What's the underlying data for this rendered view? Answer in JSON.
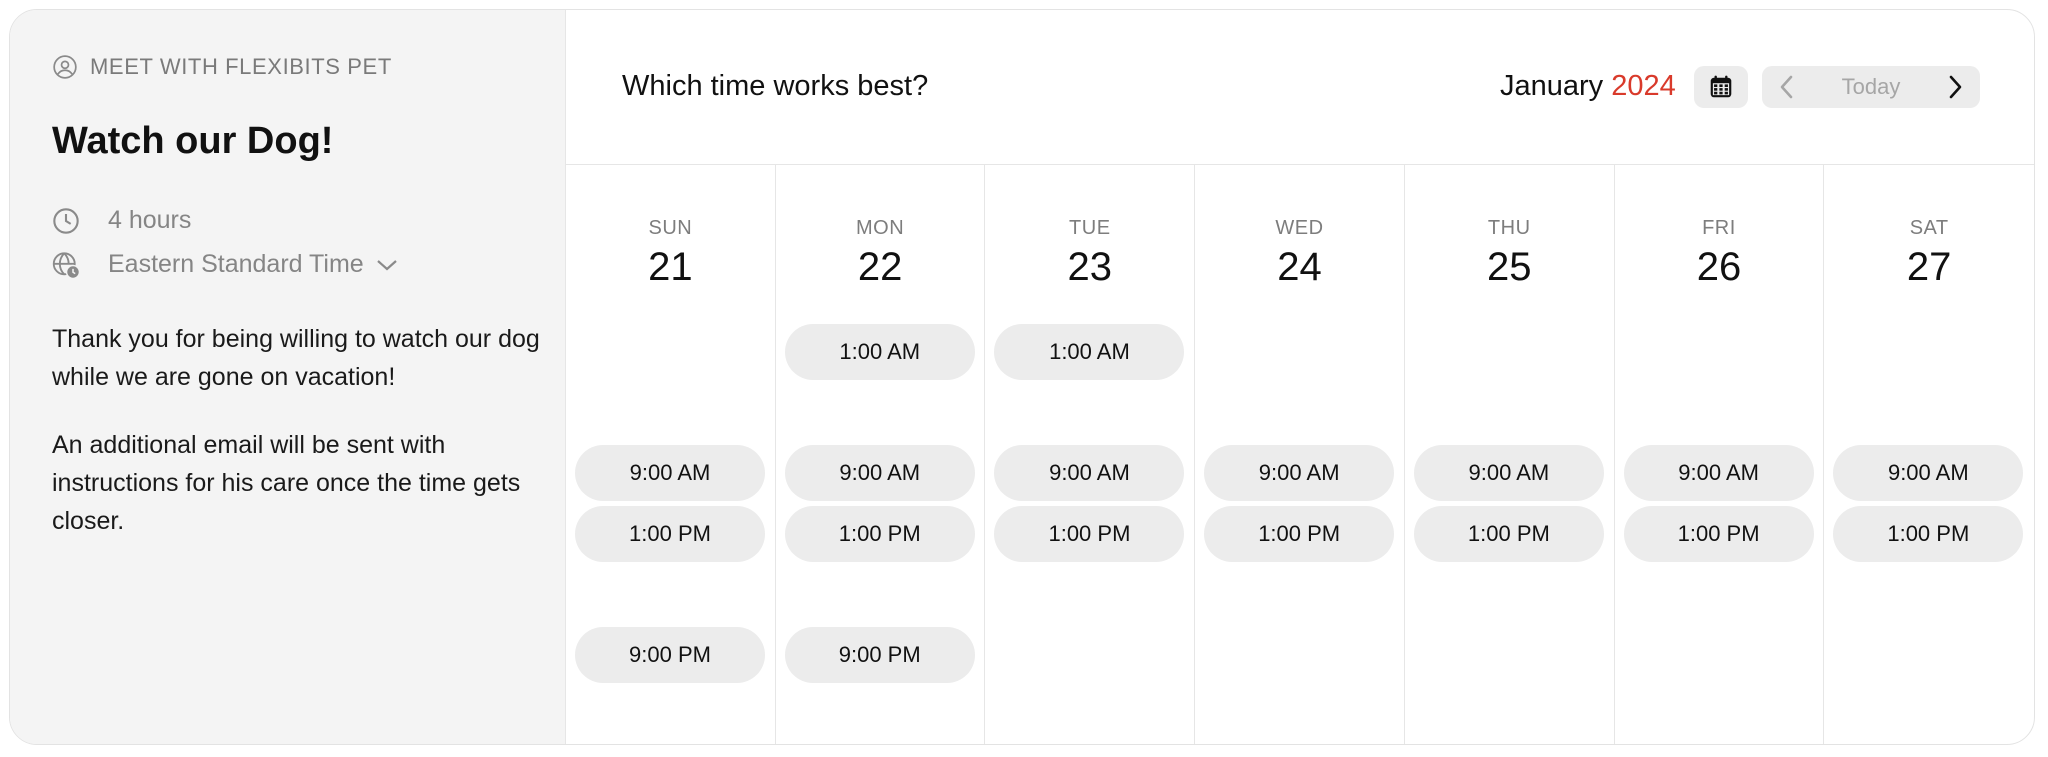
{
  "sidebar": {
    "meet_with": "MEET WITH FLEXIBITS PET",
    "title": "Watch our Dog!",
    "duration": "4 hours",
    "timezone": "Eastern Standard Time",
    "description": [
      "Thank you for being willing to watch our dog while we are gone on vacation!",
      "An additional email will be sent with instructions for his care once the time gets closer."
    ]
  },
  "header": {
    "question": "Which time works best?",
    "month": "January",
    "year": "2024",
    "today_label": "Today"
  },
  "colors": {
    "accent_year": "#d93a2b",
    "slot_bg": "#ececec",
    "sidebar_bg": "#f4f4f4"
  },
  "icons": {
    "person": "person-circle-icon",
    "clock": "clock-icon",
    "timezone": "globe-clock-icon",
    "chevron": "chevron-down-icon",
    "calendar": "calendar-icon",
    "prev": "chevron-left-icon",
    "next": "chevron-right-icon"
  },
  "days": [
    {
      "name": "SUN",
      "date": "21",
      "slots": [
        "",
        "9:00 AM",
        "1:00 PM",
        "9:00 PM"
      ]
    },
    {
      "name": "MON",
      "date": "22",
      "slots": [
        "1:00 AM",
        "9:00 AM",
        "1:00 PM",
        "9:00 PM"
      ]
    },
    {
      "name": "TUE",
      "date": "23",
      "slots": [
        "1:00 AM",
        "9:00 AM",
        "1:00 PM",
        ""
      ]
    },
    {
      "name": "WED",
      "date": "24",
      "slots": [
        "",
        "9:00 AM",
        "1:00 PM",
        ""
      ]
    },
    {
      "name": "THU",
      "date": "25",
      "slots": [
        "",
        "9:00 AM",
        "1:00 PM",
        ""
      ]
    },
    {
      "name": "FRI",
      "date": "26",
      "slots": [
        "",
        "9:00 AM",
        "1:00 PM",
        ""
      ]
    },
    {
      "name": "SAT",
      "date": "27",
      "slots": [
        "",
        "9:00 AM",
        "1:00 PM",
        ""
      ]
    }
  ]
}
